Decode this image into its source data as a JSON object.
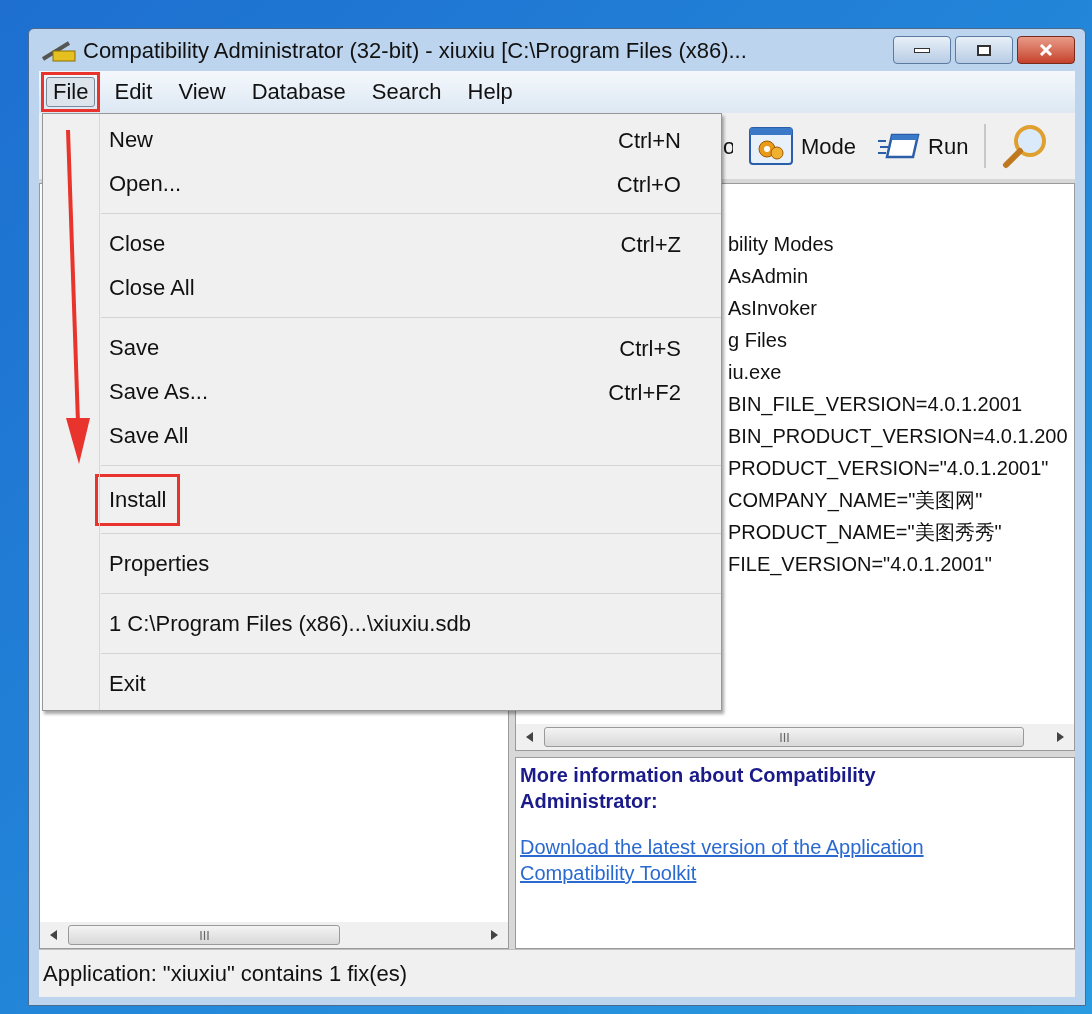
{
  "window": {
    "title": "Compatibility Administrator (32-bit) - xiuxiu [C:\\Program Files (x86)..."
  },
  "menu_bar": [
    {
      "label": "File",
      "selected": true,
      "annotated": true
    },
    {
      "label": "Edit",
      "selected": false,
      "annotated": false
    },
    {
      "label": "View",
      "selected": false,
      "annotated": false
    },
    {
      "label": "Database",
      "selected": false,
      "annotated": false
    },
    {
      "label": "Search",
      "selected": false,
      "annotated": false
    },
    {
      "label": "Help",
      "selected": false,
      "annotated": false
    }
  ],
  "file_menu": {
    "groups": [
      [
        {
          "label": "New",
          "shortcut": "Ctrl+N",
          "annotated": false
        },
        {
          "label": "Open...",
          "shortcut": "Ctrl+O",
          "annotated": false
        }
      ],
      [
        {
          "label": "Close",
          "shortcut": "Ctrl+Z",
          "annotated": false
        },
        {
          "label": "Close All",
          "annotated": false
        }
      ],
      [
        {
          "label": "Save",
          "shortcut": "Ctrl+S",
          "annotated": false
        },
        {
          "label": "Save As...",
          "shortcut": "Ctrl+F2",
          "annotated": false
        },
        {
          "label": "Save All",
          "annotated": false
        }
      ],
      [
        {
          "label": "Install",
          "annotated": true
        }
      ],
      [
        {
          "label": "Properties",
          "annotated": false
        }
      ],
      [
        {
          "label": "1 C:\\Program Files (x86)...\\xiuxiu.sdb",
          "annotated": false
        }
      ],
      [
        {
          "label": "Exit",
          "annotated": false
        }
      ]
    ]
  },
  "toolbar": [
    {
      "label": "o",
      "kind": "text"
    },
    {
      "label": "Mode",
      "kind": "mode"
    },
    {
      "label": "Run",
      "kind": "run"
    },
    {
      "kind": "separator"
    },
    {
      "kind": "search"
    }
  ],
  "tree": [
    "bility Modes",
    "AsAdmin",
    "AsInvoker",
    "g Files",
    "iu.exe",
    "BIN_FILE_VERSION=4.0.1.2001",
    "BIN_PRODUCT_VERSION=4.0.1.200",
    "PRODUCT_VERSION=\"4.0.1.2001\"",
    "COMPANY_NAME=\"美图网\"",
    "PRODUCT_NAME=\"美图秀秀\"",
    "FILE_VERSION=\"4.0.1.2001\""
  ],
  "info": {
    "heading": "More information about Compatibility Administrator:",
    "link": "Download the latest version of the Application Compatibility Toolkit"
  },
  "status_bar": "Application: \"xiuxiu\" contains 1 fix(es)"
}
